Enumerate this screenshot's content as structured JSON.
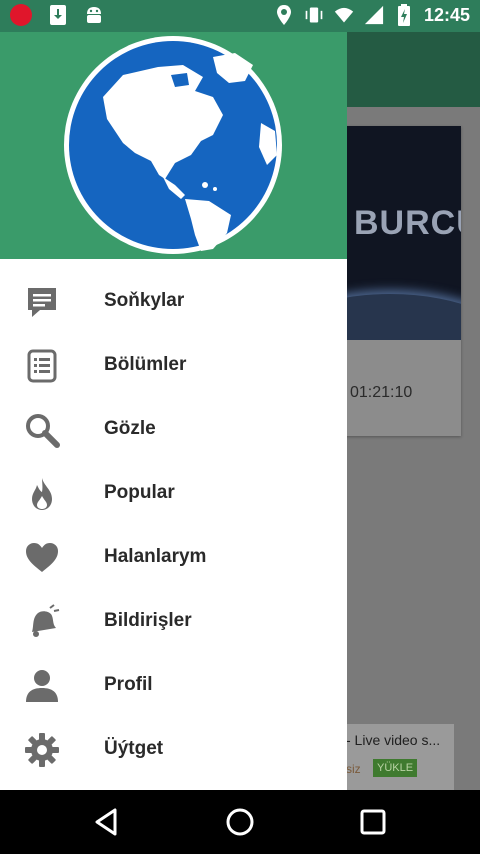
{
  "status_bar": {
    "time": "12:45",
    "icons": [
      "record-icon",
      "download-icon",
      "android-icon",
      "location-icon",
      "vibrate-icon",
      "wifi-icon",
      "signal-icon",
      "battery-icon"
    ]
  },
  "background": {
    "video_thumb_title": "BURCU",
    "video_duration": "01:21:10",
    "ad_text": "- Live video s...",
    "ad_small": "siz",
    "ad_button": "YÜKLE"
  },
  "drawer": {
    "header_icon": "globe-icon",
    "items": [
      {
        "label": "Soňkylar",
        "icon": "chat-icon"
      },
      {
        "label": "Bölümler",
        "icon": "list-icon"
      },
      {
        "label": "Gözle",
        "icon": "search-icon"
      },
      {
        "label": "Popular",
        "icon": "fire-icon"
      },
      {
        "label": "Halanlarym",
        "icon": "heart-icon"
      },
      {
        "label": "Bildirişler",
        "icon": "bell-icon"
      },
      {
        "label": "Profil",
        "icon": "person-icon"
      },
      {
        "label": "Üýtget",
        "icon": "gear-icon"
      }
    ]
  },
  "colors": {
    "status_bar": "#2e7d5b",
    "drawer_header": "#3a9b6a",
    "icon_gray": "#6b6b6b",
    "globe_blue": "#1565c0"
  },
  "nav_bar": {
    "buttons": [
      "back-icon",
      "home-icon",
      "recents-icon"
    ]
  }
}
